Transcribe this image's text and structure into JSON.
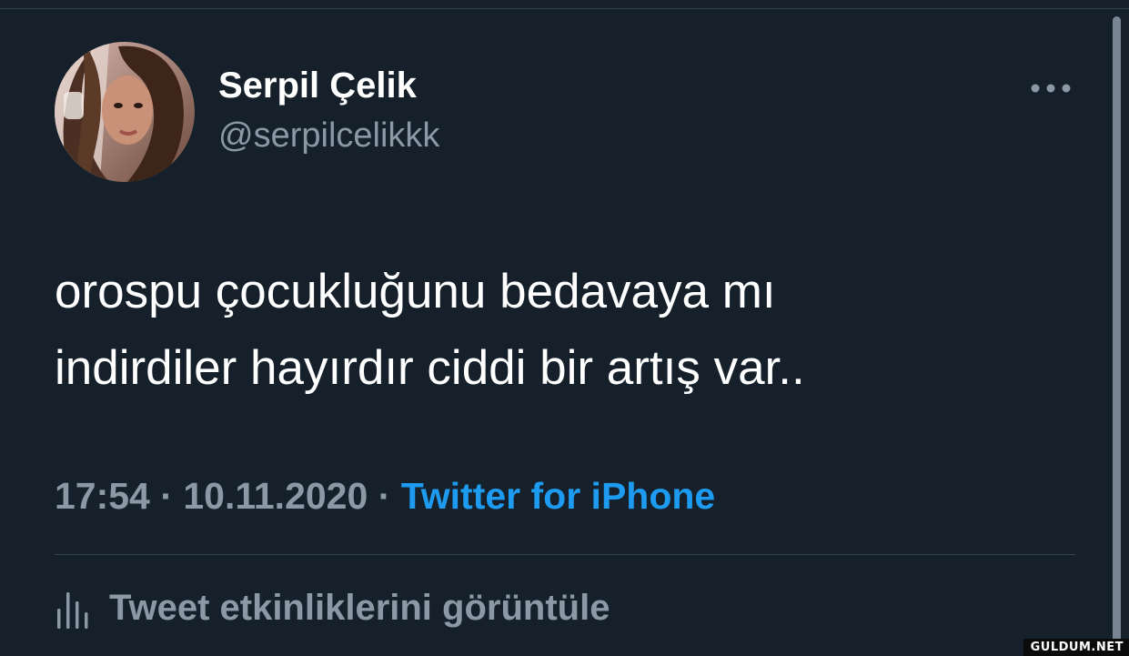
{
  "author": {
    "display_name": "Serpil Çelik",
    "handle": "@serpilcelikkk"
  },
  "tweet": {
    "text_lines": [
      "orospu çocukluğunu bedavaya mı",
      "indirdiler hayırdır ciddi bir artış var.."
    ],
    "time": "17:54",
    "date": "10.11.2020",
    "separator": "·",
    "source": "Twitter for iPhone"
  },
  "actions": {
    "activity_label": "Tweet etkinliklerini görüntüle",
    "more_icon": "more-horizontal-icon",
    "activity_icon": "bar-chart-icon"
  },
  "watermark": "GULDUM.NET",
  "colors": {
    "background": "#15202b",
    "primary_text": "#ffffff",
    "secondary_text": "#8b98a5",
    "accent": "#1d9bf0",
    "divider": "#38444d"
  }
}
